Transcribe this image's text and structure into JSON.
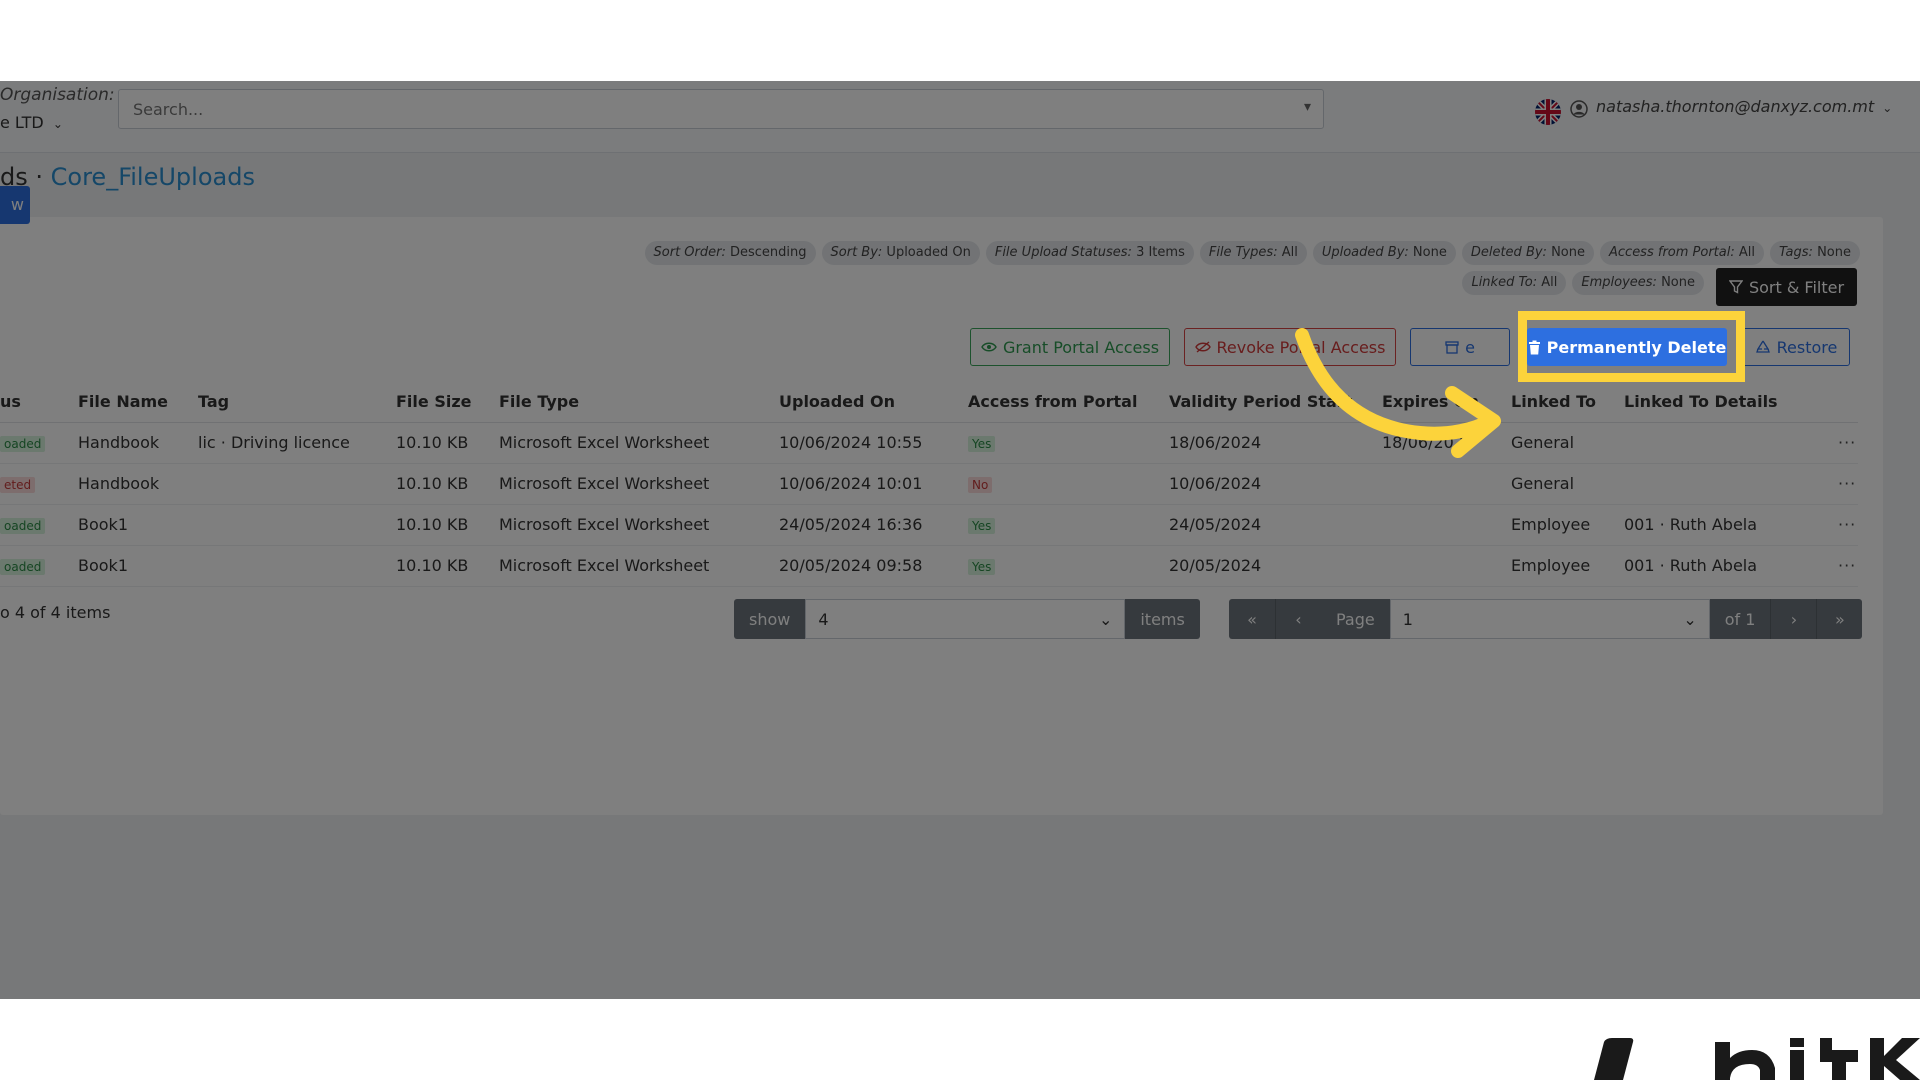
{
  "topbar": {
    "org_label": "Organisation:",
    "org_value": "e LTD",
    "search_placeholder": "Search...",
    "user_email": "natasha.thornton@danxyz.com.mt"
  },
  "breadcrumb": {
    "parent": "ds",
    "separator": " · ",
    "current": "Core_FileUploads"
  },
  "toolbar": {
    "new_label": "w",
    "chips": [
      {
        "key": "Sort Order:",
        "value": " Descending"
      },
      {
        "key": "Sort By:",
        "value": " Uploaded On"
      },
      {
        "key": "File Upload Statuses:",
        "value": " 3 Items"
      },
      {
        "key": "File Types:",
        "value": " All"
      },
      {
        "key": "Uploaded By:",
        "value": " None"
      },
      {
        "key": "Deleted By:",
        "value": " None"
      },
      {
        "key": "Access from Portal:",
        "value": " All"
      },
      {
        "key": "Tags:",
        "value": " None"
      },
      {
        "key": "Linked To:",
        "value": " All"
      },
      {
        "key": "Employees:",
        "value": " None"
      }
    ],
    "sort_filter_label": "Sort & Filter",
    "grant_label": "Grant Portal Access",
    "revoke_label": "Revoke Portal Access",
    "archive_label": "e",
    "perm_delete_label": "Permanently Delete",
    "restore_label": "Restore"
  },
  "table": {
    "headers": [
      "us",
      "File Name",
      "Tag",
      "File Size",
      "File Type",
      "Uploaded On",
      "Access from Portal",
      "Validity Period Start",
      "Expires On",
      "Linked To",
      "Linked To Details"
    ],
    "rows": [
      {
        "status": "oaded",
        "status_color": "green",
        "file_name": "Handbook",
        "tag": "lic · Driving licence",
        "size": "10.10 KB",
        "type": "Microsoft Excel Worksheet",
        "uploaded": "10/06/2024 10:55",
        "access": "Yes",
        "validity": "18/06/2024",
        "expires": "18/06/2027",
        "linked": "General",
        "details": ""
      },
      {
        "status": "eted",
        "status_color": "red",
        "file_name": "Handbook",
        "tag": "",
        "size": "10.10 KB",
        "type": "Microsoft Excel Worksheet",
        "uploaded": "10/06/2024 10:01",
        "access": "No",
        "validity": "10/06/2024",
        "expires": "",
        "linked": "General",
        "details": ""
      },
      {
        "status": "oaded",
        "status_color": "green",
        "file_name": "Book1",
        "tag": "",
        "size": "10.10 KB",
        "type": "Microsoft Excel Worksheet",
        "uploaded": "24/05/2024 16:36",
        "access": "Yes",
        "validity": "24/05/2024",
        "expires": "",
        "linked": "Employee",
        "details": "001 · Ruth Abela"
      },
      {
        "status": "oaded",
        "status_color": "green",
        "file_name": "Book1",
        "tag": "",
        "size": "10.10 KB",
        "type": "Microsoft Excel Worksheet",
        "uploaded": "20/05/2024 09:58",
        "access": "Yes",
        "validity": "20/05/2024",
        "expires": "",
        "linked": "Employee",
        "details": "001 · Ruth Abela"
      }
    ],
    "row_menu": "···"
  },
  "footer": {
    "summary": "o 4 of 4 items",
    "show_label": "show",
    "page_size": "4",
    "items_label": "items",
    "page_label": "Page",
    "page_value": "1",
    "of_label": "of 1"
  },
  "colors": {
    "primary": "#2d6fe0",
    "highlight": "#fcd33b",
    "success": "#3aa55a",
    "danger": "#d64545"
  }
}
